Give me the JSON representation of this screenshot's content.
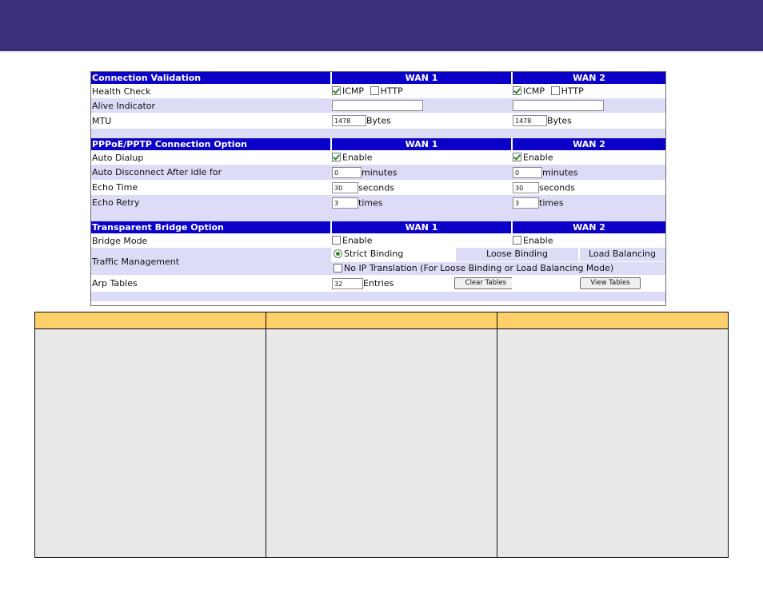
{
  "colors": {
    "banner": "#3b2f7a",
    "section_header": "#0b00c8",
    "alt_row": "#dcdcf7",
    "column_header": "#fdd06a",
    "panel_bg": "#e8e8e8"
  },
  "connection_validation": {
    "title": "Connection Validation",
    "wan1": "WAN 1",
    "wan2": "WAN 2",
    "health_check": {
      "label": "Health Check",
      "icmp": "ICMP",
      "http": "HTTP",
      "wan1_icmp": true,
      "wan1_http": false,
      "wan2_icmp": true,
      "wan2_http": false
    },
    "alive_indicator": {
      "label": "Alive Indicator",
      "wan1_value": "",
      "wan2_value": ""
    },
    "mtu": {
      "label": "MTU",
      "wan1_value": "1478",
      "wan2_value": "1478",
      "unit": "Bytes"
    }
  },
  "pppoe": {
    "title": "PPPoE/PPTP Connection Option",
    "wan1": "WAN 1",
    "wan2": "WAN 2",
    "auto_dialup": {
      "label": "Auto Dialup",
      "option": "Enable",
      "wan1": true,
      "wan2": true
    },
    "auto_disconnect": {
      "label": "Auto Disconnect After idle for",
      "wan1_value": "0",
      "wan2_value": "0",
      "unit": "minutes"
    },
    "echo_time": {
      "label": "Echo Time",
      "wan1_value": "30",
      "wan2_value": "30",
      "unit": "seconds"
    },
    "echo_retry": {
      "label": "Echo Retry",
      "wan1_value": "3",
      "wan2_value": "3",
      "unit": "times"
    }
  },
  "bridge": {
    "title": "Transparent Bridge Option",
    "wan1": "WAN 1",
    "wan2": "WAN 2",
    "bridge_mode": {
      "label": "Bridge Mode",
      "option": "Enable",
      "wan1": false,
      "wan2": false
    },
    "traffic_management": {
      "label": "Traffic Management",
      "options": [
        "Strict Binding",
        "Loose Binding",
        "Load Balancing"
      ],
      "selected": "Strict Binding",
      "no_ip_translation": "No IP Translation (For Loose Binding or Load Balancing Mode)",
      "no_ip_translation_checked": false
    },
    "arp_tables": {
      "label": "Arp Tables",
      "value": "32",
      "unit": "Entries",
      "clear_button": "Clear Tables",
      "view_button": "View Tables"
    }
  }
}
